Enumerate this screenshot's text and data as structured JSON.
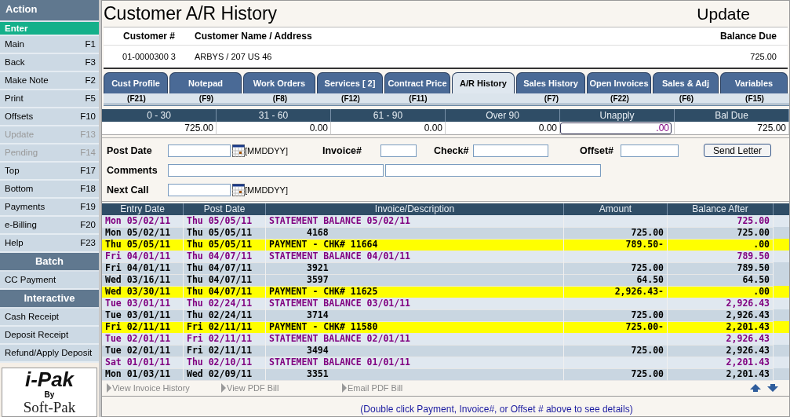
{
  "sidebar": {
    "sections": [
      {
        "title": "Action",
        "kind": "action",
        "items": [
          {
            "label": "Enter",
            "selected": true,
            "disabled": false
          },
          {
            "label": "Main",
            "key": "F1",
            "selected": false,
            "disabled": false
          },
          {
            "label": "Back",
            "key": "F3",
            "selected": false,
            "disabled": false
          },
          {
            "label": "Make Note",
            "key": "F2",
            "selected": false,
            "disabled": false
          },
          {
            "label": "Print",
            "key": "F5",
            "selected": false,
            "disabled": false
          },
          {
            "label": "Offsets",
            "key": "F10",
            "selected": false,
            "disabled": false
          },
          {
            "label": "Update",
            "key": "F13",
            "selected": false,
            "disabled": true
          },
          {
            "label": "Pending",
            "key": "F14",
            "selected": false,
            "disabled": true
          },
          {
            "label": "Top",
            "key": "F17",
            "selected": false,
            "disabled": false
          },
          {
            "label": "Bottom",
            "key": "F18",
            "selected": false,
            "disabled": false
          },
          {
            "label": "Payments",
            "key": "F19",
            "selected": false,
            "disabled": false
          },
          {
            "label": "e-Billing",
            "key": "F20",
            "selected": false,
            "disabled": false
          },
          {
            "label": "Help",
            "key": "F23",
            "selected": false,
            "disabled": false
          }
        ]
      },
      {
        "title": "Batch",
        "kind": "group",
        "items": [
          {
            "label": "CC Payment",
            "selected": false,
            "disabled": false
          }
        ]
      },
      {
        "title": "Interactive",
        "kind": "group",
        "items": [
          {
            "label": "Cash Receipt",
            "selected": false,
            "disabled": false
          },
          {
            "label": "Deposit Receipt",
            "selected": false,
            "disabled": false
          },
          {
            "label": "Refund/Apply Deposit",
            "selected": false,
            "disabled": false
          }
        ]
      }
    ],
    "logo": {
      "name": "i-Pak",
      "by": "By",
      "maker": "Soft-Pak"
    }
  },
  "page": {
    "title": "Customer A/R History",
    "mode": "Update"
  },
  "customer": {
    "columns": [
      "Customer #",
      "Customer Name / Address",
      "Balance Due"
    ],
    "values": [
      "01-0000300 3",
      "ARBYS  /  207 US 46",
      "725.00"
    ]
  },
  "tabs": [
    {
      "label": "Cust Profile",
      "key": "(F21)",
      "selected": false
    },
    {
      "label": "Notepad",
      "key": "(F9)",
      "selected": false
    },
    {
      "label": "Work Orders",
      "key": "(F8)",
      "selected": false
    },
    {
      "label": "Services [    2]",
      "key": "(F12)",
      "selected": false
    },
    {
      "label": "Contract Price",
      "key": "(F11)",
      "selected": false
    },
    {
      "label": "A/R History",
      "selected": true
    },
    {
      "label": "Sales History",
      "key": "(F7)",
      "selected": false
    },
    {
      "label": "Open Invoices",
      "key": "(F22)",
      "selected": false
    },
    {
      "label": "Sales & Adj",
      "key": "(F6)",
      "selected": false
    },
    {
      "label": "Variables",
      "key": "(F15)",
      "selected": false
    }
  ],
  "aging": [
    {
      "label": "0 - 30",
      "value": "725.00",
      "kind": "text"
    },
    {
      "label": "31 - 60",
      "value": "0.00",
      "kind": "text"
    },
    {
      "label": "61 - 90",
      "value": "0.00",
      "kind": "text"
    },
    {
      "label": "Over 90",
      "value": "0.00",
      "kind": "text"
    },
    {
      "label": "Unapply",
      "value": ".00",
      "kind": "field"
    },
    {
      "label": "Bal Due",
      "value": "725.00",
      "kind": "text"
    }
  ],
  "form": {
    "post_date": {
      "label": "Post Date",
      "hint": "[MMDDYY]"
    },
    "invoice": {
      "label": "Invoice#"
    },
    "check": {
      "label": "Check#"
    },
    "offset": {
      "label": "Offset#"
    },
    "send_letter": "Send Letter",
    "comments": {
      "label": "Comments"
    },
    "next_call": {
      "label": "Next Call",
      "hint": "[MMDDYY]"
    }
  },
  "history": {
    "columns": [
      "Entry Date",
      "Post Date",
      "Invoice/Description",
      "Amount",
      "Balance After"
    ],
    "rows": [
      {
        "kind": "statement",
        "entry": "Mon 05/02/11",
        "post": "Thu 05/05/11",
        "description": "STATEMENT BALANCE 05/02/11",
        "amount": "",
        "balance": "725.00"
      },
      {
        "kind": "invoice",
        "entry": "Mon 05/02/11",
        "post": "Thu 05/05/11",
        "description": "4168",
        "amount": "725.00",
        "balance": "725.00"
      },
      {
        "kind": "payment",
        "entry": "Thu 05/05/11",
        "post": "Thu 05/05/11",
        "description": "PAYMENT - CHK# 11664",
        "amount": "789.50-",
        "balance": ".00"
      },
      {
        "kind": "statement",
        "entry": "Fri 04/01/11",
        "post": "Thu 04/07/11",
        "description": "STATEMENT BALANCE 04/01/11",
        "amount": "",
        "balance": "789.50"
      },
      {
        "kind": "invoice",
        "entry": "Fri 04/01/11",
        "post": "Thu 04/07/11",
        "description": "3921",
        "amount": "725.00",
        "balance": "789.50"
      },
      {
        "kind": "invoice",
        "entry": "Wed 03/16/11",
        "post": "Thu 04/07/11",
        "description": "3597",
        "amount": "64.50",
        "balance": "64.50"
      },
      {
        "kind": "payment",
        "entry": "Wed 03/30/11",
        "post": "Thu 04/07/11",
        "description": "PAYMENT - CHK# 11625",
        "amount": "2,926.43-",
        "balance": ".00"
      },
      {
        "kind": "statement",
        "entry": "Tue 03/01/11",
        "post": "Thu 02/24/11",
        "description": "STATEMENT BALANCE 03/01/11",
        "amount": "",
        "balance": "2,926.43"
      },
      {
        "kind": "invoice",
        "entry": "Tue 03/01/11",
        "post": "Thu 02/24/11",
        "description": "3714",
        "amount": "725.00",
        "balance": "2,926.43"
      },
      {
        "kind": "payment",
        "entry": "Fri 02/11/11",
        "post": "Fri 02/11/11",
        "description": "PAYMENT - CHK# 11580",
        "amount": "725.00-",
        "balance": "2,201.43"
      },
      {
        "kind": "statement",
        "entry": "Tue 02/01/11",
        "post": "Fri 02/11/11",
        "description": "STATEMENT BALANCE 02/01/11",
        "amount": "",
        "balance": "2,926.43"
      },
      {
        "kind": "invoice",
        "entry": "Tue 02/01/11",
        "post": "Fri 02/11/11",
        "description": "3494",
        "amount": "725.00",
        "balance": "2,926.43"
      },
      {
        "kind": "statement",
        "entry": "Sat 01/01/11",
        "post": "Thu 02/10/11",
        "description": "STATEMENT BALANCE 01/01/11",
        "amount": "",
        "balance": "2,201.43"
      },
      {
        "kind": "invoice",
        "entry": "Mon 01/03/11",
        "post": "Wed 02/09/11",
        "description": "3351",
        "amount": "725.00",
        "balance": "2,201.43"
      }
    ]
  },
  "links": [
    "View Invoice History",
    "View PDF Bill",
    "Email PDF Bill"
  ],
  "footer_note": "(Double click Payment, Invoice#, or Offset # above to see details)"
}
